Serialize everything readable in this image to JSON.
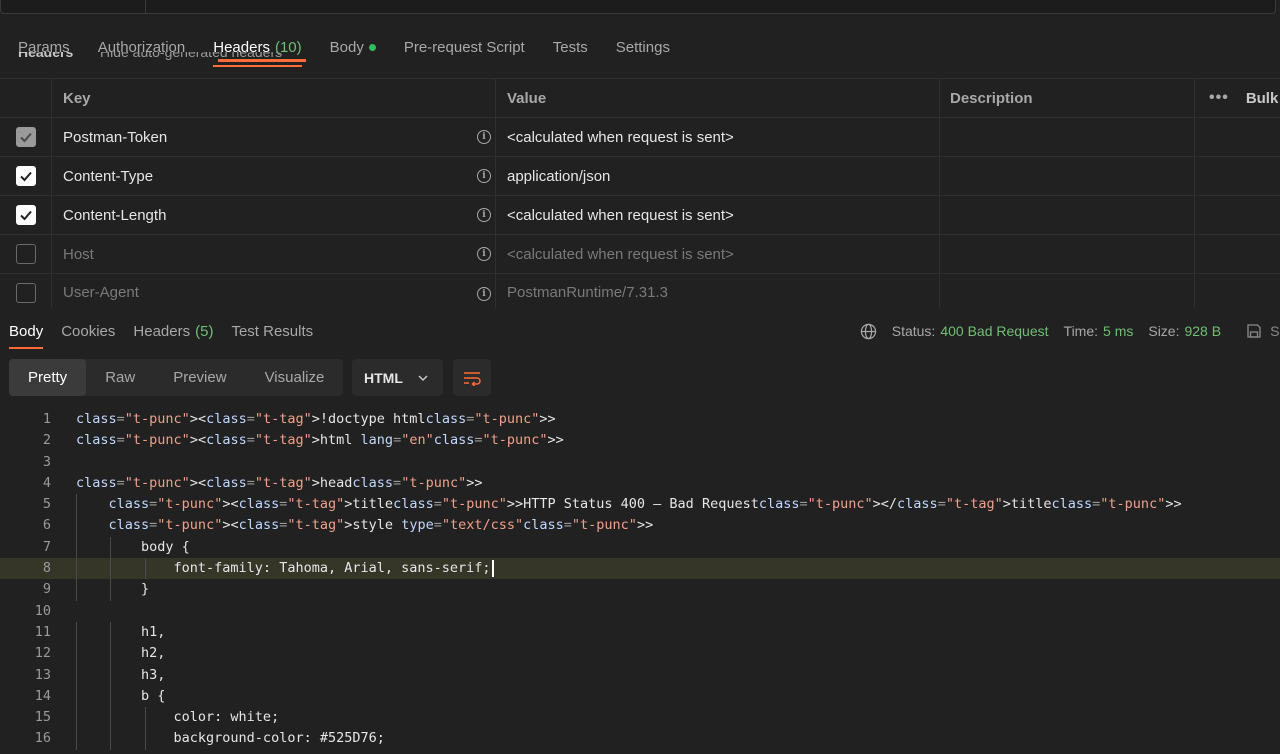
{
  "request_tabs": {
    "params": "Params",
    "authorization": "Authorization",
    "headers": "Headers",
    "headers_count": "(10)",
    "body": "Body",
    "prerequest": "Pre-request Script",
    "tests": "Tests",
    "settings": "Settings"
  },
  "headers_section": {
    "label": "Headers",
    "auto_note": "Hide auto-generated headers"
  },
  "headers_table": {
    "columns": {
      "key": "Key",
      "value": "Value",
      "description": "Description",
      "bulk_edit": "Bulk Edit"
    },
    "rows": [
      {
        "key": "Postman-Token",
        "value": "<calculated when request is sent>",
        "enabled": true,
        "locked": true
      },
      {
        "key": "Content-Type",
        "value": "application/json",
        "enabled": true,
        "locked": false
      },
      {
        "key": "Content-Length",
        "value": "<calculated when request is sent>",
        "enabled": true,
        "locked": false
      },
      {
        "key": "Host",
        "value": "<calculated when request is sent>",
        "enabled": false,
        "locked": false
      },
      {
        "key": "User-Agent",
        "value": "PostmanRuntime/7.31.3",
        "enabled": false,
        "locked": false
      }
    ]
  },
  "response_tabs": {
    "body": "Body",
    "cookies": "Cookies",
    "headers": "Headers",
    "headers_count": "(5)",
    "test_results": "Test Results"
  },
  "response_status": {
    "status_label": "Status:",
    "status_value": "400 Bad Request",
    "time_label": "Time:",
    "time_value": "5 ms",
    "size_label": "Size:",
    "size_value": "928 B",
    "save_label": "Save"
  },
  "view_modes": {
    "pretty": "Pretty",
    "raw": "Raw",
    "preview": "Preview",
    "visualize": "Visualize",
    "selected": "Pretty"
  },
  "format_select": {
    "value": "HTML"
  },
  "colors": {
    "accent": "#ff6c37",
    "success": "#6fbf73",
    "body_dot": "#2fbd5e",
    "background": "#212121"
  },
  "code_lines": [
    {
      "n": "1",
      "text": "<!doctype html>"
    },
    {
      "n": "2",
      "text": "<html lang=\"en\">"
    },
    {
      "n": "3",
      "text": ""
    },
    {
      "n": "4",
      "text": "<head>"
    },
    {
      "n": "5",
      "text": "    <title>HTTP Status 400 – Bad Request</title>"
    },
    {
      "n": "6",
      "text": "    <style type=\"text/css\">"
    },
    {
      "n": "7",
      "text": "        body {"
    },
    {
      "n": "8",
      "text": "            font-family: Tahoma, Arial, sans-serif;"
    },
    {
      "n": "9",
      "text": "        }"
    },
    {
      "n": "10",
      "text": ""
    },
    {
      "n": "11",
      "text": "        h1,"
    },
    {
      "n": "12",
      "text": "        h2,"
    },
    {
      "n": "13",
      "text": "        h3,"
    },
    {
      "n": "14",
      "text": "        b {"
    },
    {
      "n": "15",
      "text": "            color: white;"
    },
    {
      "n": "16",
      "text": "            background-color: #525D76;"
    }
  ]
}
